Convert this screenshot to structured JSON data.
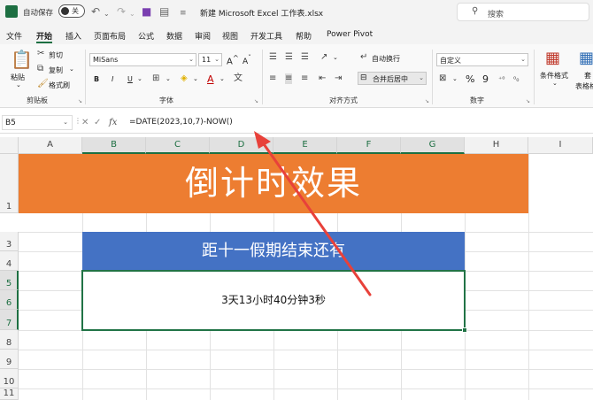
{
  "titlebar": {
    "autosave_label": "自动保存",
    "autosave_state": "关",
    "document_title": "新建 Microsoft Excel 工作表.xlsx",
    "search_placeholder": "搜索"
  },
  "menu": {
    "tabs": [
      "文件",
      "开始",
      "插入",
      "页面布局",
      "公式",
      "数据",
      "审阅",
      "视图",
      "开发工具",
      "帮助",
      "Power Pivot"
    ],
    "active_tab": "开始"
  },
  "ribbon": {
    "clipboard": {
      "paste": "粘贴",
      "cut": "剪切",
      "copy": "复制",
      "format_painter": "格式刷",
      "group_label": "剪贴板"
    },
    "font": {
      "font_name": "MiSans",
      "font_size": "11",
      "bold": "B",
      "italic": "I",
      "underline": "U",
      "group_label": "字体"
    },
    "alignment": {
      "wrap_text": "自动换行",
      "merge_center": "合并后居中",
      "group_label": "对齐方式"
    },
    "number": {
      "format": "自定义",
      "percent": "%",
      "comma": "9",
      "group_label": "数字"
    },
    "styles": {
      "conditional_format": "条件格式",
      "format_as_table": "套",
      "table_format_tail": "表格格"
    }
  },
  "formula_bar": {
    "name_box": "B5",
    "fx": "fx",
    "formula": "=DATE(2023,10,7)-NOW()"
  },
  "sheet": {
    "columns": [
      "A",
      "B",
      "C",
      "D",
      "E",
      "F",
      "G",
      "H",
      "I"
    ],
    "rows": [
      "1",
      "3",
      "4",
      "5",
      "6",
      "7",
      "8",
      "9",
      "10",
      "11"
    ],
    "selected_rows": [
      "5",
      "6",
      "7"
    ],
    "selected_columns": [
      "B",
      "C",
      "D",
      "E",
      "F",
      "G"
    ],
    "banner_text": "倒计时效果",
    "subtitle_text": "距十一假期结束还有",
    "countdown_text": "3天13小时40分钟3秒"
  },
  "colors": {
    "banner_bg": "#ed7d31",
    "subtitle_bg": "#4472c4",
    "selection": "#217346",
    "arrow": "#e8413a"
  }
}
